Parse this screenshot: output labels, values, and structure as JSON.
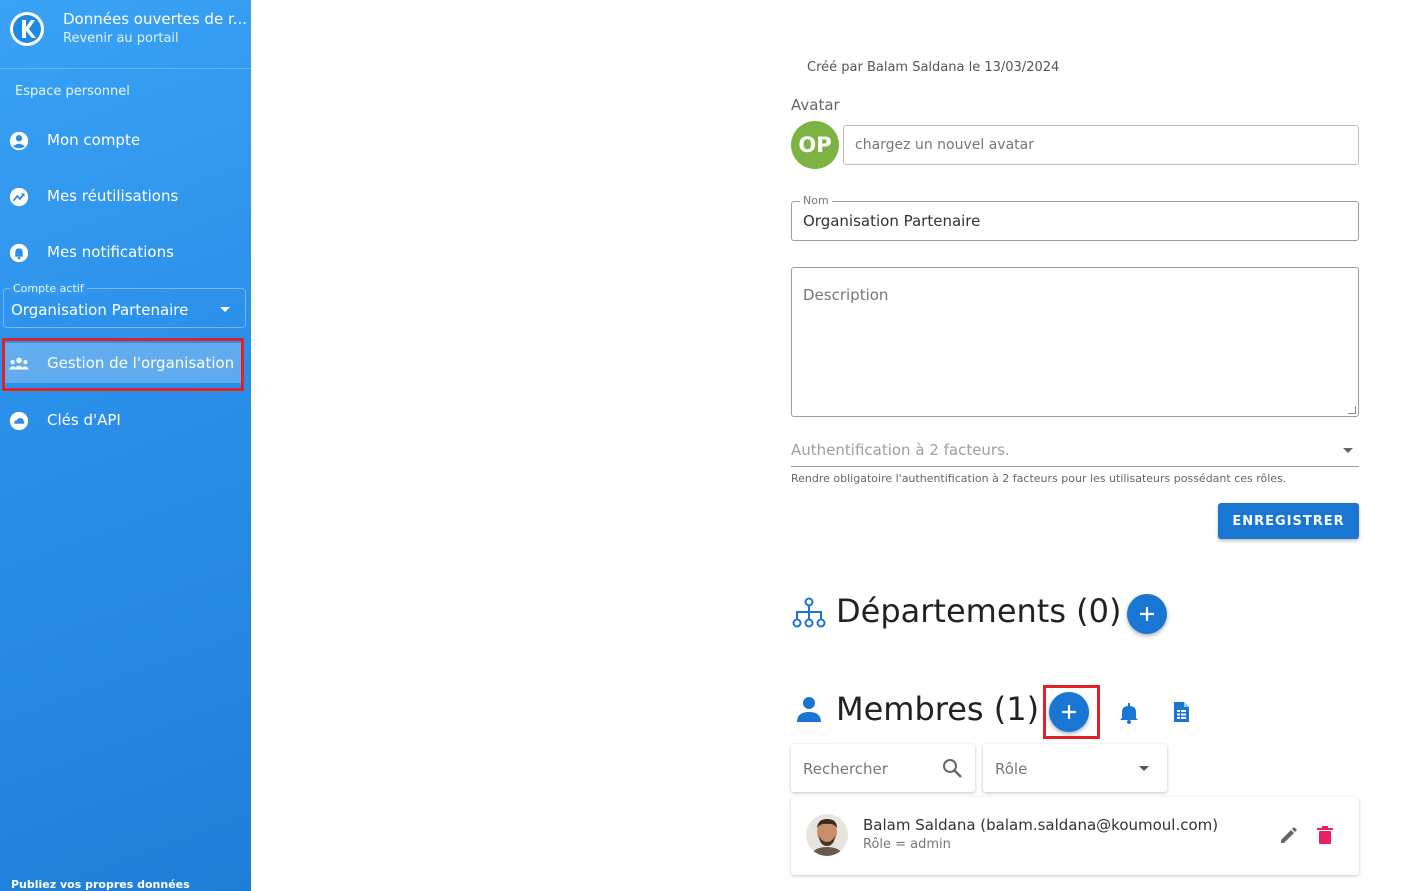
{
  "brand": {
    "title": "Données ouvertes de r...",
    "subtitle": "Revenir au portail"
  },
  "sidebar": {
    "section_label": "Espace personnel",
    "items": [
      {
        "label": "Mon compte",
        "icon": "account-circle-icon"
      },
      {
        "label": "Mes réutilisations",
        "icon": "share-arrow-icon"
      },
      {
        "label": "Mes notifications",
        "icon": "bell-icon"
      },
      {
        "label": "Gestion de l'organisation",
        "icon": "group-icon",
        "active": true
      },
      {
        "label": "Clés d'API",
        "icon": "cloud-icon"
      }
    ],
    "active_account": {
      "legend": "Compte actif",
      "value": "Organisation Partenaire"
    },
    "footer": "Publiez vos propres données"
  },
  "org": {
    "created_by": "Créé par Balam Saldana le 13/03/2024",
    "avatar_label": "Avatar",
    "avatar_initials": "OP",
    "avatar_input_placeholder": "chargez un nouvel avatar",
    "name_legend": "Nom",
    "name_value": "Organisation Partenaire",
    "description_placeholder": "Description",
    "tfa_placeholder": "Authentification à 2 facteurs.",
    "tfa_hint": "Rendre obligatoire l'authentification à 2 facteurs pour les utilisateurs possédant ces rôles.",
    "save_label": "ENREGISTRER"
  },
  "departments": {
    "title": "Départements (0)"
  },
  "members": {
    "title": "Membres (1)",
    "search_placeholder": "Rechercher",
    "role_placeholder": "Rôle",
    "list": [
      {
        "name": "Balam Saldana (balam.saldana@koumoul.com)",
        "role": "Rôle = admin"
      }
    ]
  },
  "colors": {
    "primary": "#1976d2",
    "avatar_green": "#7cb342",
    "delete_pink": "#e91e63",
    "highlight_red": "#e0202b"
  }
}
